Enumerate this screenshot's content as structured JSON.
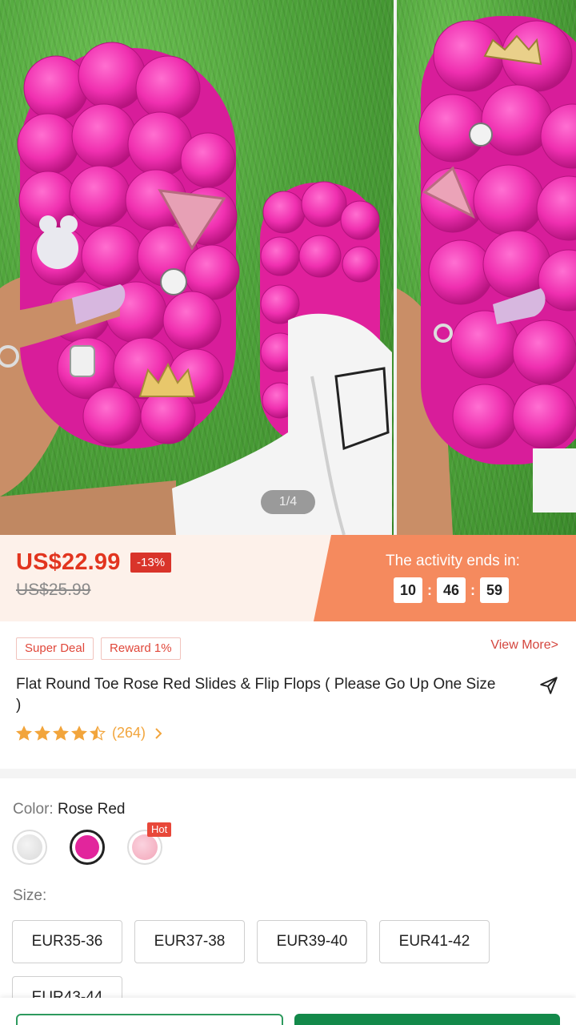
{
  "gallery": {
    "counter": "1/4"
  },
  "price": {
    "current": "US$22.99",
    "discount": "-13%",
    "original": "US$25.99"
  },
  "activity": {
    "title": "The activity ends in:",
    "hours": "10",
    "minutes": "46",
    "seconds": "59",
    "separator": ":"
  },
  "tags": [
    "Super Deal",
    "Reward 1%"
  ],
  "view_more": "View More>",
  "product": {
    "title": "Flat Round Toe Rose Red Slides & Flip Flops ( Please Go Up One Size )"
  },
  "rating": {
    "stars": 4.5,
    "count": "(264)"
  },
  "color": {
    "label": "Color:",
    "selected": "Rose Red",
    "hot_badge": "Hot",
    "swatch_colors": [
      "#d9d9d9",
      "#e2259c",
      "#f2a5b8"
    ]
  },
  "size": {
    "label": "Size:",
    "options": [
      "EUR35-36",
      "EUR37-38",
      "EUR39-40",
      "EUR41-42",
      "EUR43-44"
    ]
  },
  "colors": {
    "accent_red": "#e2351f",
    "activity_orange": "#f58a5e",
    "buy_green": "#13894a",
    "star": "#f2a53c"
  }
}
